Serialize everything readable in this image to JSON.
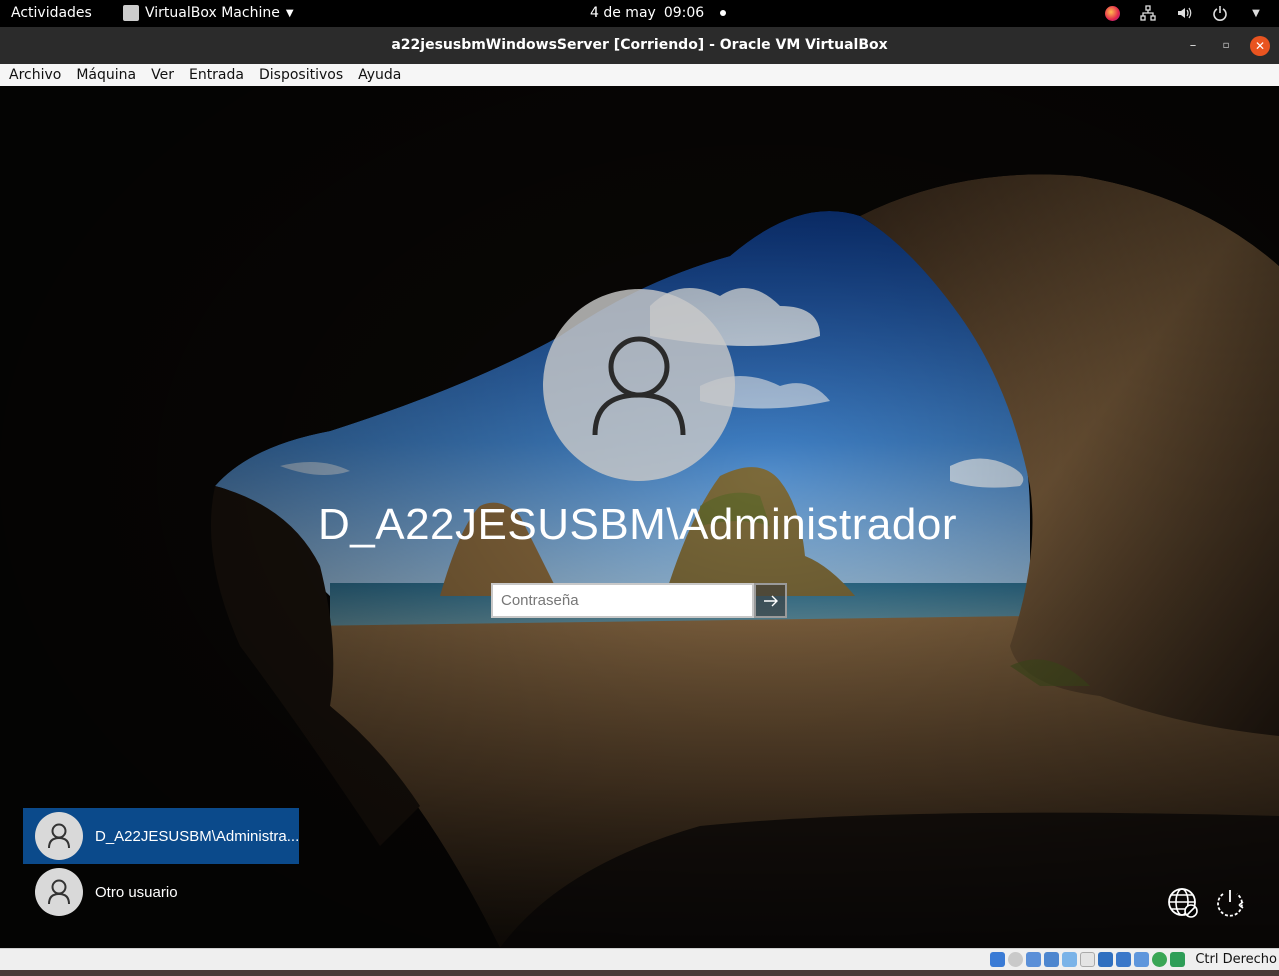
{
  "topbar": {
    "activities": "Actividades",
    "app_name": "VirtualBox Machine",
    "date": "4 de may",
    "time": "09:06"
  },
  "window": {
    "title": "a22jesusbmWindowsServer [Corriendo] - Oracle VM VirtualBox",
    "close_color": "#e95420"
  },
  "menubar": {
    "items": [
      "Archivo",
      "Máquina",
      "Ver",
      "Entrada",
      "Dispositivos",
      "Ayuda"
    ]
  },
  "login": {
    "username": "D_A22JESUSBM\\Administrador",
    "password_placeholder": "Contraseña",
    "users": [
      {
        "label": "D_A22JESUSBM\\Administra...",
        "selected": true
      },
      {
        "label": "Otro usuario",
        "selected": false
      }
    ],
    "selected_color": "#0b4a8b"
  },
  "statusbar": {
    "host_key": "Ctrl Derecho"
  }
}
